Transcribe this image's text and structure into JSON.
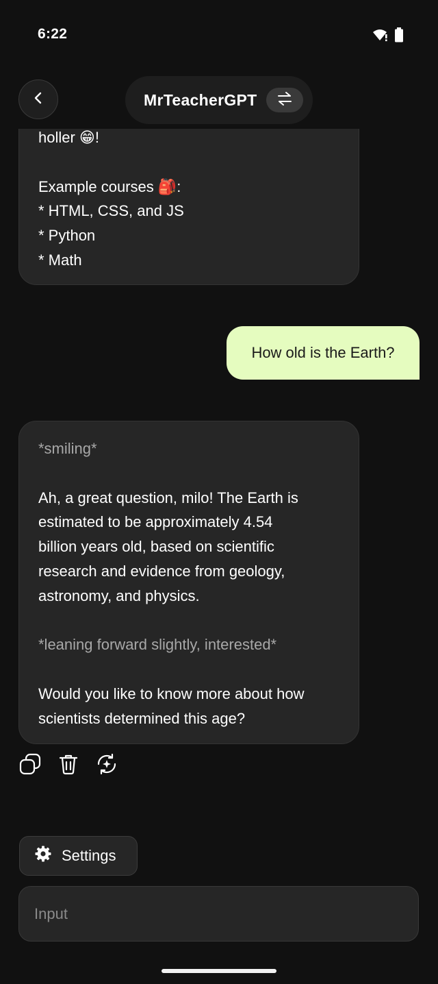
{
  "status": {
    "time": "6:22",
    "icons": [
      "wifi-alert-icon",
      "battery-icon"
    ]
  },
  "header": {
    "back_icon": "chevron-left-icon",
    "title": "MrTeacherGPT",
    "swap_icon": "swap-arrows-icon"
  },
  "messages": {
    "previous_bot": {
      "lines": [
        "holler 😁!",
        "",
        "Example courses 🎒:",
        "* HTML, CSS, and JS",
        "* Python",
        "* Math"
      ]
    },
    "user": {
      "text": "How old is the Earth?"
    },
    "bot_reply": {
      "lines": [
        "*smiling*",
        "",
        "Ah, a great question, milo! The Earth is",
        "estimated to be approximately 4.54",
        "billion years old, based on scientific",
        "research and evidence from geology,",
        "astronomy, and physics.",
        "",
        "*leaning forward slightly, interested*",
        "",
        "Would you like to know more about how",
        "scientists determined this age?"
      ]
    }
  },
  "actions": {
    "icons": [
      "copy-icon",
      "trash-icon",
      "regenerate-icon"
    ]
  },
  "settings": {
    "label": "Settings",
    "icon": "gear-icon"
  },
  "composer": {
    "placeholder": "Input",
    "value": ""
  },
  "colors": {
    "background": "#111111",
    "bot_bubble": "#262626",
    "user_bubble": "#e5fcbf",
    "muted_text": "#a8a8a8"
  }
}
